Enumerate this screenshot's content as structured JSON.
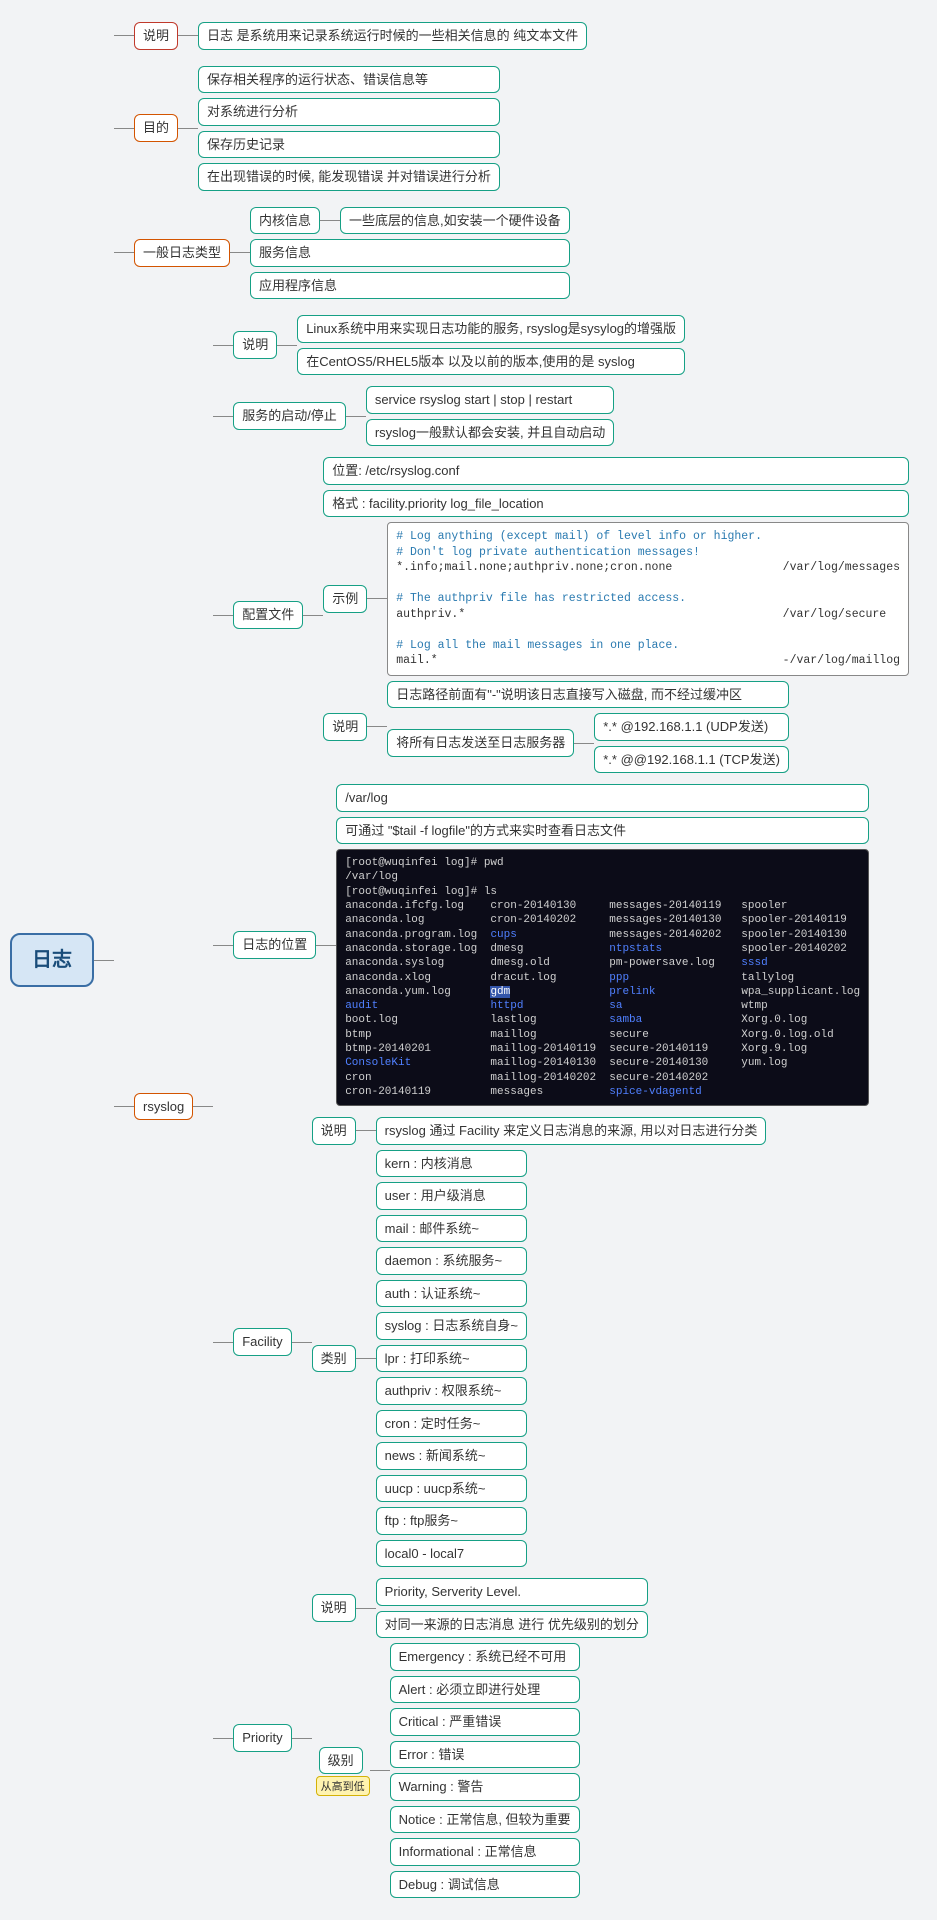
{
  "root": "日志",
  "n_desc": "说明",
  "n_desc_c": "日志 是系统用来记录系统运行时候的一些相关信息的 纯文本文件",
  "n_goal": "目的",
  "goal": [
    "保存相关程序的运行状态、错误信息等",
    "对系统进行分析",
    "保存历史记录",
    "在出现错误的时候, 能发现错误 并对错误进行分析"
  ],
  "n_types": "一般日志类型",
  "types_kern": "内核信息",
  "types_kern_c": "一些底层的信息,如安装一个硬件设备",
  "types_svc": "服务信息",
  "types_app": "应用程序信息",
  "n_rsyslog": "rsyslog",
  "rs_desc": "说明",
  "rs_desc_1": "Linux系统中用来实现日志功能的服务, rsyslog是sysylog的增强版",
  "rs_desc_2": "在CentOS5/RHEL5版本 以及以前的版本,使用的是 syslog",
  "rs_start": "服务的启动/停止",
  "rs_start_1": "service rsyslog start | stop | restart",
  "rs_start_2": "rsyslog一般默认都会安装, 并且自动启动",
  "rs_conf": "配置文件",
  "rs_conf_loc": "位置: /etc/rsyslog.conf",
  "rs_conf_fmt": "格式 : facility.priority       log_file_location",
  "rs_conf_ex": "示例",
  "rs_conf_ex_body": "# Log anything (except mail) of level info or higher.\n# Don't log private authentication messages!\n*.info;mail.none;authpriv.none;cron.none                /var/log/messages\n\n# The authpriv file has restricted access.\nauthpriv.*                                              /var/log/secure\n\n# Log all the mail messages in one place.\nmail.*                                                  -/var/log/maillog",
  "rs_conf_note": "说明",
  "rs_conf_note_1": "日志路径前面有\"-\"说明该日志直接写入磁盘, 而不经过缓冲区",
  "rs_conf_note_2": "将所有日志发送至日志服务器",
  "rs_conf_note_2a": "*.*        @192.168.1.1     (UDP发送)",
  "rs_conf_note_2b": "*.*        @@192.168.1.1    (TCP发送)",
  "rs_loc": "日志的位置",
  "rs_loc_1": "/var/log",
  "rs_loc_2": "可通过 \"$tail -f logfile\"的方式来实时查看日志文件",
  "rs_fac": "Facility",
  "rs_fac_desc": "说明",
  "rs_fac_desc_c": "rsyslog 通过 Facility 来定义日志消息的来源, 用以对日志进行分类",
  "rs_fac_cat": "类别",
  "fac": [
    "kern       : 内核消息",
    "user       : 用户级消息",
    "mail       : 邮件系统~",
    "daemon           : 系统服务~",
    "auth       : 认证系统~",
    "syslog   : 日志系统自身~",
    "lpr         : 打印系统~",
    "authpriv            : 权限系统~",
    "cron      : 定时任务~",
    "news     : 新闻系统~",
    "uucp      : uucp系统~",
    "ftp         : ftp服务~",
    "local0 - local7"
  ],
  "rs_pri": "Priority",
  "rs_pri_desc": "说明",
  "rs_pri_desc_1": "Priority, Serverity Level.",
  "rs_pri_desc_2": "对同一来源的日志消息 进行 优先级别的划分",
  "rs_pri_lvl": "级别",
  "rs_pri_lvl_tag": "从高到低",
  "pri": [
    "Emergency        : 系统已经不可用",
    "Alert     : 必须立即进行处理",
    "Critical  : 严重错误",
    "Error     : 错误",
    "Warning           : 警告",
    "Notice   : 正常信息, 但较为重要",
    "Informational     : 正常信息",
    "Debug   : 调试信息"
  ]
}
